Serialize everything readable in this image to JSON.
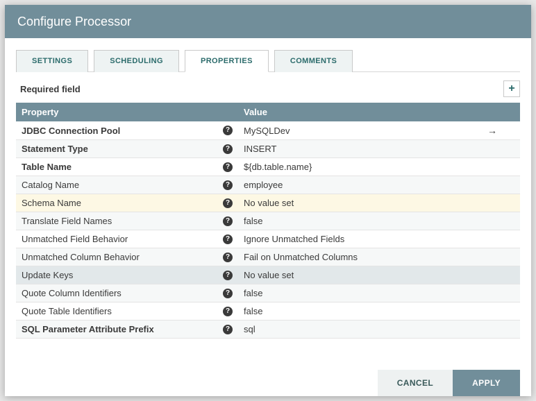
{
  "title": "Configure Processor",
  "tabs": [
    {
      "label": "SETTINGS",
      "active": false
    },
    {
      "label": "SCHEDULING",
      "active": false
    },
    {
      "label": "PROPERTIES",
      "active": true
    },
    {
      "label": "COMMENTS",
      "active": false
    }
  ],
  "required_label": "Required field",
  "columns": {
    "property": "Property",
    "value": "Value"
  },
  "rows": [
    {
      "name": "JDBC Connection Pool",
      "value": "MySQLDev",
      "bold": true,
      "noValue": false,
      "goto": true
    },
    {
      "name": "Statement Type",
      "value": "INSERT",
      "bold": true,
      "noValue": false,
      "goto": false
    },
    {
      "name": "Table Name",
      "value": "${db.table.name}",
      "bold": true,
      "noValue": false,
      "goto": false
    },
    {
      "name": "Catalog Name",
      "value": "employee",
      "bold": false,
      "noValue": false,
      "goto": false
    },
    {
      "name": "Schema Name",
      "value": "No value set",
      "bold": false,
      "noValue": true,
      "goto": false,
      "highlight": true
    },
    {
      "name": "Translate Field Names",
      "value": "false",
      "bold": false,
      "noValue": false,
      "goto": false
    },
    {
      "name": "Unmatched Field Behavior",
      "value": "Ignore Unmatched Fields",
      "bold": false,
      "noValue": false,
      "goto": false
    },
    {
      "name": "Unmatched Column Behavior",
      "value": "Fail on Unmatched Columns",
      "bold": false,
      "noValue": false,
      "goto": false
    },
    {
      "name": "Update Keys",
      "value": "No value set",
      "bold": false,
      "noValue": true,
      "goto": false,
      "selected": true
    },
    {
      "name": "Quote Column Identifiers",
      "value": "false",
      "bold": false,
      "noValue": false,
      "goto": false
    },
    {
      "name": "Quote Table Identifiers",
      "value": "false",
      "bold": false,
      "noValue": false,
      "goto": false
    },
    {
      "name": "SQL Parameter Attribute Prefix",
      "value": "sql",
      "bold": true,
      "noValue": false,
      "goto": false
    }
  ],
  "buttons": {
    "cancel": "CANCEL",
    "apply": "APPLY"
  }
}
